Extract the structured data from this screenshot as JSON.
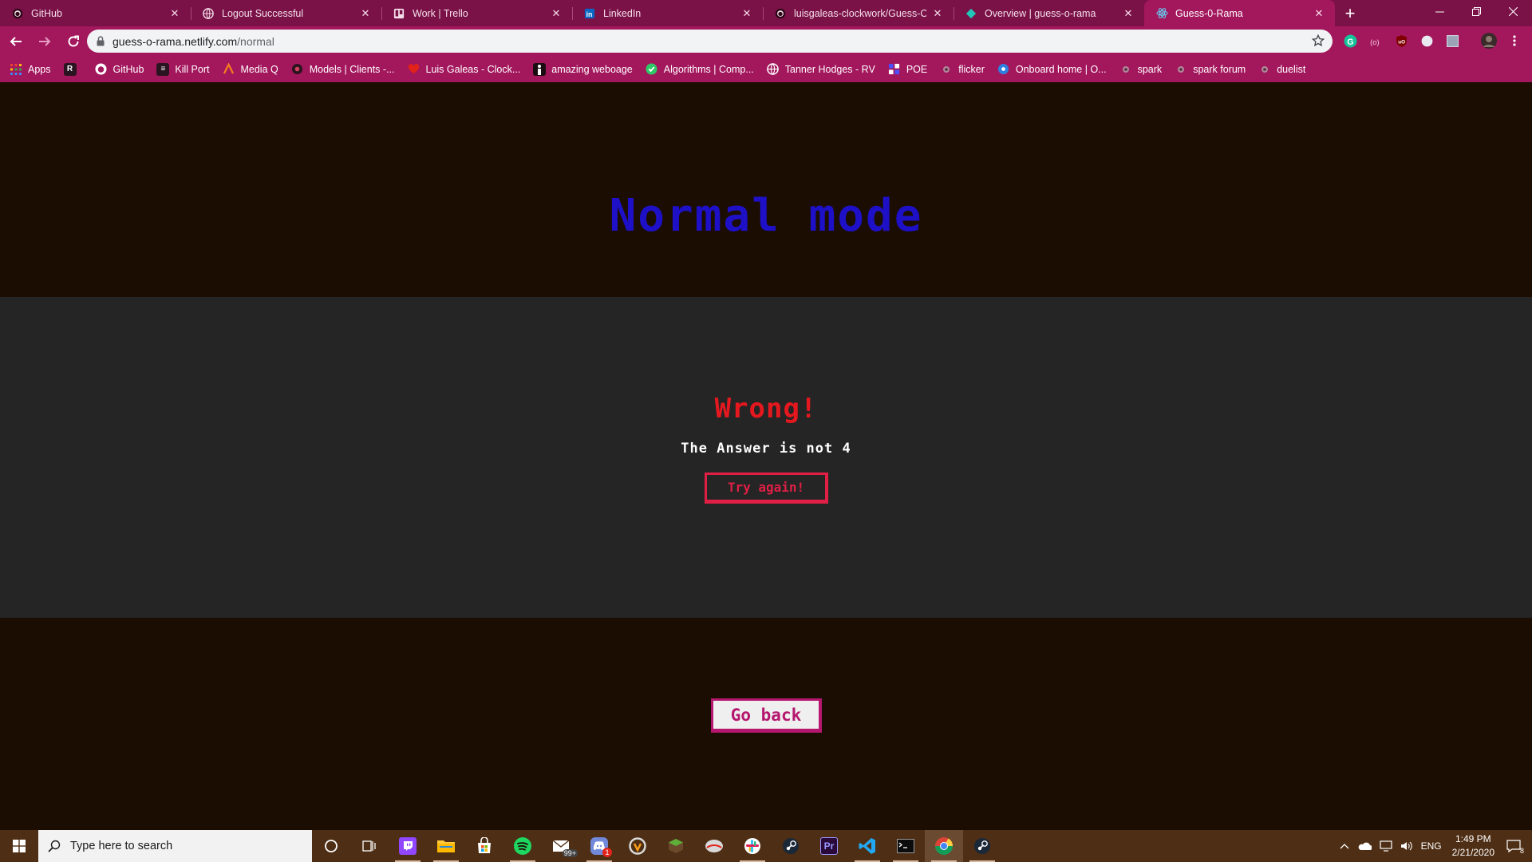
{
  "browser": {
    "tabs": [
      {
        "title": "GitHub",
        "icon": "github-icon",
        "active": false
      },
      {
        "title": "Logout Successful",
        "icon": "globe-icon",
        "active": false
      },
      {
        "title": "Work | Trello",
        "icon": "trello-icon",
        "active": false
      },
      {
        "title": "LinkedIn",
        "icon": "linkedin-icon",
        "active": false
      },
      {
        "title": "luisgaleas-clockwork/Guess-O-R",
        "icon": "github-icon",
        "active": false
      },
      {
        "title": "Overview | guess-o-rama",
        "icon": "netlify-icon",
        "active": false
      },
      {
        "title": "Guess-0-Rama",
        "icon": "react-icon",
        "active": true
      }
    ],
    "address": {
      "host": "guess-o-rama.netlify.com",
      "path": "/normal"
    },
    "bookmarks": [
      {
        "label": "Apps",
        "icon": "apps-grid-icon"
      },
      {
        "label": "",
        "icon": "bookmark-r-icon"
      },
      {
        "label": "GitHub",
        "icon": "github-icon"
      },
      {
        "label": "Kill Port",
        "icon": "killport-icon"
      },
      {
        "label": "Media Q",
        "icon": "mediaq-icon"
      },
      {
        "label": "Models | Clients -...",
        "icon": "models-icon"
      },
      {
        "label": "Luis Galeas - Clock...",
        "icon": "heart-icon"
      },
      {
        "label": "amazing weboage",
        "icon": "figure-icon"
      },
      {
        "label": "Algorithms | Comp...",
        "icon": "shield-check-icon"
      },
      {
        "label": "Tanner Hodges - RV",
        "icon": "globe-icon"
      },
      {
        "label": "POE",
        "icon": "poe-icon"
      },
      {
        "label": "flicker",
        "icon": "flicker-icon"
      },
      {
        "label": "Onboard home | O...",
        "icon": "onboard-icon"
      },
      {
        "label": "spark",
        "icon": "spark-icon"
      },
      {
        "label": "spark forum",
        "icon": "spark-icon"
      },
      {
        "label": "duelist",
        "icon": "spark-icon"
      }
    ],
    "colors": {
      "frame": "#7a1147",
      "toolbar": "#a3175d"
    }
  },
  "page": {
    "title": "Normal mode",
    "result": {
      "heading": "Wrong!",
      "message": "The Answer is not 4",
      "retry_label": "Try again!"
    },
    "back_label": "Go back",
    "colors": {
      "background": "#1c0d03",
      "panel": "#252525",
      "title": "#1d10c7",
      "wrong": "#e6181f",
      "retry": "#e01f45",
      "back": "#b5166e"
    }
  },
  "taskbar": {
    "search_placeholder": "Type here to search",
    "apps": [
      "cortana-icon",
      "task-view-icon",
      "twitch-icon",
      "file-explorer-icon",
      "store-icon",
      "spotify-icon",
      "mail-icon",
      "discord-icon",
      "overwatch-icon",
      "minecraft-icon",
      "app-icon",
      "slack-icon",
      "steam-icon",
      "premiere-icon",
      "vscode-icon",
      "terminal-icon",
      "chrome-icon",
      "steam-icon"
    ],
    "mail_badge": "99+",
    "discord_badge": "1",
    "language": "ENG",
    "time": "1:49 PM",
    "date": "2/21/2020",
    "notification_count": "8"
  }
}
